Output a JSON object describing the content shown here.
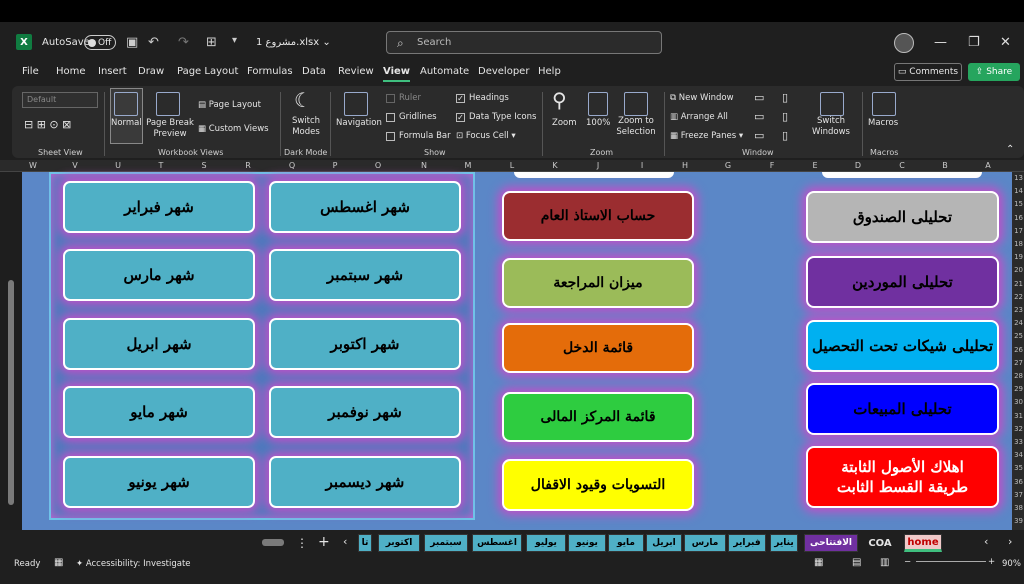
{
  "titlebar": {
    "autosave_label": "AutoSave",
    "autosave_state": "Off",
    "filename": "مشروع 1.xlsx",
    "search_placeholder": "Search"
  },
  "menu_tabs": [
    "File",
    "Home",
    "Insert",
    "Draw",
    "Page Layout",
    "Formulas",
    "Data",
    "Review",
    "View",
    "Automate",
    "Developer",
    "Help"
  ],
  "active_tab": "View",
  "header_actions": {
    "comments": "Comments",
    "share": "Share"
  },
  "ribbon": {
    "sheet_view": {
      "dropdown": "Default",
      "label": "Sheet View"
    },
    "workbook_views": {
      "normal": "Normal",
      "page_break": "Page Break Preview",
      "page_layout": "Page Layout",
      "custom_views": "Custom Views",
      "label": "Workbook Views"
    },
    "dark_mode": {
      "switch_modes": "Switch Modes",
      "label": "Dark Mode"
    },
    "show": {
      "navigation": "Navigation",
      "ruler": "Ruler",
      "gridlines": "Gridlines",
      "formula_bar": "Formula Bar",
      "headings": "Headings",
      "data_type_icons": "Data Type Icons",
      "focus_cell": "Focus Cell",
      "label": "Show"
    },
    "zoom": {
      "zoom": "Zoom",
      "hundred": "100%",
      "zoom_to_selection": "Zoom to Selection",
      "label": "Zoom"
    },
    "window": {
      "new_window": "New Window",
      "arrange_all": "Arrange All",
      "freeze_panes": "Freeze Panes",
      "switch_windows": "Switch Windows",
      "label": "Window"
    },
    "macros": {
      "macros": "Macros",
      "label": "Macros"
    }
  },
  "columns": [
    "W",
    "V",
    "U",
    "T",
    "S",
    "R",
    "Q",
    "P",
    "O",
    "N",
    "M",
    "L",
    "K",
    "J",
    "I",
    "H",
    "G",
    "F",
    "E",
    "D",
    "C",
    "B",
    "A"
  ],
  "rows": [
    "13",
    "14",
    "15",
    "16",
    "17",
    "18",
    "19",
    "20",
    "21",
    "22",
    "23",
    "24",
    "25",
    "26",
    "27",
    "28",
    "29",
    "30",
    "31",
    "32",
    "33",
    "34",
    "35",
    "36",
    "37",
    "38",
    "39"
  ],
  "months": {
    "col_left": [
      "شهر فبراير",
      "شهر مارس",
      "شهر ابريل",
      "شهر مايو",
      "شهر يونيو"
    ],
    "col_right": [
      "شهر اغسطس",
      "شهر سبتمبر",
      "شهر اكتوبر",
      "شهر نوفمبر",
      "شهر ديسمبر"
    ]
  },
  "middle_buttons": [
    {
      "label": "حساب الاستاذ العام",
      "color": "#9b2d30"
    },
    {
      "label": "ميزان المراجعة",
      "color": "#9bbb59"
    },
    {
      "label": "قائمة الدخل",
      "color": "#e46c0a"
    },
    {
      "label": "قائمة المركز المالى",
      "color": "#2ecc40"
    },
    {
      "label": "التسويات وقيود الاقفال",
      "color": "#ffff00"
    }
  ],
  "right_buttons": [
    {
      "label": "تحليلى الصندوق",
      "color": "#b5b5b5"
    },
    {
      "label": "تحليلى الموردين",
      "color": "#7030a0"
    },
    {
      "label": "تحليلى شيكات تحت التحصيل",
      "color": "#00b0f0"
    },
    {
      "label": "تحليلى المبيعات",
      "color": "#0000ff"
    },
    {
      "label": "اهلاك الأصول الثابتة\nطريقة القسط الثابت",
      "color": "#ff0000"
    }
  ],
  "sheet_tabs": [
    "تا",
    "اكتوبر",
    "سبتمبر",
    "اغسطس",
    "يوليو",
    "يونيو",
    "مايو",
    "ابريل",
    "مارس",
    "فبراير",
    "يناير",
    "الافتتاحى",
    "COA",
    "home"
  ],
  "status": {
    "ready": "Ready",
    "accessibility": "Accessibility: Investigate",
    "zoom": "90%"
  }
}
